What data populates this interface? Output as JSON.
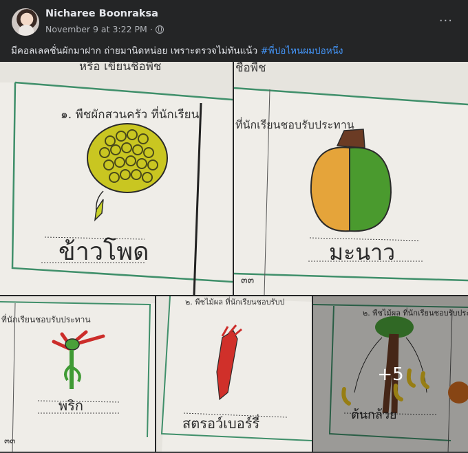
{
  "post": {
    "author": "Nicharee Boonraksa",
    "date": "November 9 at 3:22 PM",
    "separator": "·",
    "more_icon": "···",
    "caption_text": "มีคอลเลคชั่นผักมาฝาก ถ่ายมานิดหน่อย เพราะตรวจไม่ทันแน้ว ",
    "caption_hashtag": "#พี่ปอไหนผมปอหนึ่ง"
  },
  "photos": [
    {
      "header": "๑. พืชผักสวนครัว ที่นักเรียน",
      "top_text": "หรือ เขียนชื่อพืช",
      "label": "ข้าวโพด",
      "page": ""
    },
    {
      "header": "ที่นักเรียนชอบรับประทาน",
      "top_text": "ชื่อพืช",
      "label": "มะนาว",
      "page": "๓๓"
    },
    {
      "header": "ที่นักเรียนชอบรับประทาน",
      "label": "พริก",
      "page": "๓๓"
    },
    {
      "header": "๒. พืชไม้ผล ที่นักเรียนชอบรับป",
      "label": "สตรอว์เบอร์รี่",
      "page": ""
    },
    {
      "header": "๒. พืชไม้ผล ที่นักเรียนชอบรับประ",
      "label": "ต้นกล้วย",
      "page": ""
    }
  ],
  "more_photos": "+5",
  "colors": {
    "background": "#242526",
    "text": "#e4e6eb",
    "secondary": "#b0b3b8",
    "link": "#4599ff",
    "paper": "#e9e7e1",
    "frame": "#3f8f6a"
  }
}
